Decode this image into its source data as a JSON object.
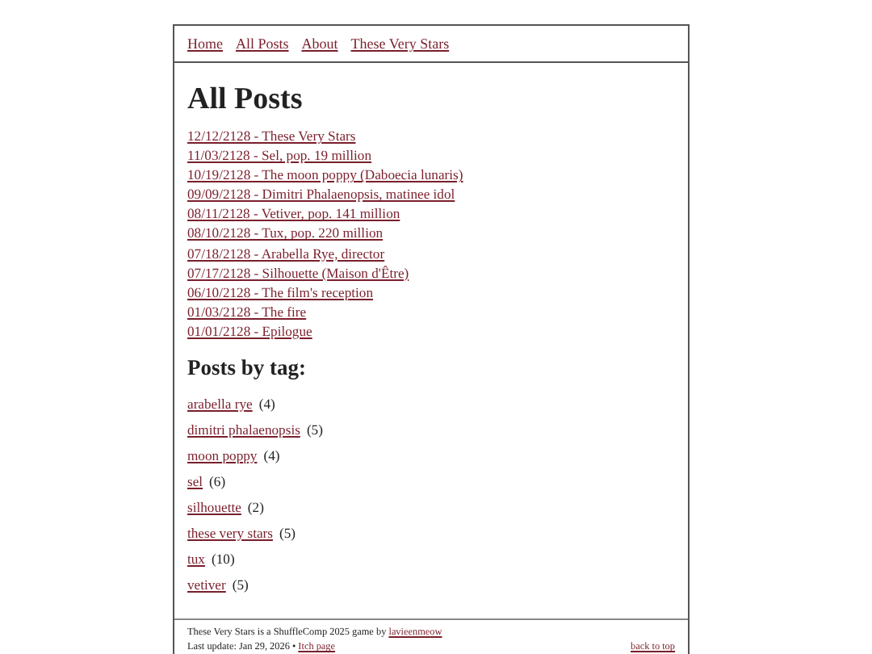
{
  "nav": {
    "links": [
      "Home",
      "All Posts",
      "About",
      "These Very Stars"
    ]
  },
  "heading": "All Posts",
  "posts": [
    "12/12/2128 - These Very Stars",
    "11/03/2128 - Sel, pop. 19 million",
    "10/19/2128 - The moon poppy (Daboecia lunaris)",
    "09/09/2128 - Dimitri Phalaenopsis, matinee idol",
    "08/11/2128 - Vetiver, pop. 141 million",
    "08/10/2128 - Tux, pop. 220 million",
    "07/18/2128 - Arabella Rye, director",
    "07/17/2128 - Silhouette (Maison d'Être)",
    "06/10/2128 - The film's reception",
    "01/03/2128 - The fire",
    "01/01/2128 - Epilogue"
  ],
  "tags_heading": "Posts by tag:",
  "tags": [
    {
      "name": "arabella rye",
      "count": "(4)"
    },
    {
      "name": "dimitri phalaenopsis",
      "count": "(5)"
    },
    {
      "name": "moon poppy",
      "count": "(4)"
    },
    {
      "name": "sel",
      "count": "(6)"
    },
    {
      "name": "silhouette",
      "count": "(2)"
    },
    {
      "name": "these very stars",
      "count": "(5)"
    },
    {
      "name": "tux",
      "count": "(10)"
    },
    {
      "name": "vetiver",
      "count": "(5)"
    }
  ],
  "footer": {
    "credit_text": "These Very Stars is a ShuffleComp 2025 game by",
    "credit_link": "lavieenmeow",
    "update_text": "Last update: Jan 29, 2026 •",
    "update_link": "Itch page",
    "back_to_top": "back to top"
  }
}
